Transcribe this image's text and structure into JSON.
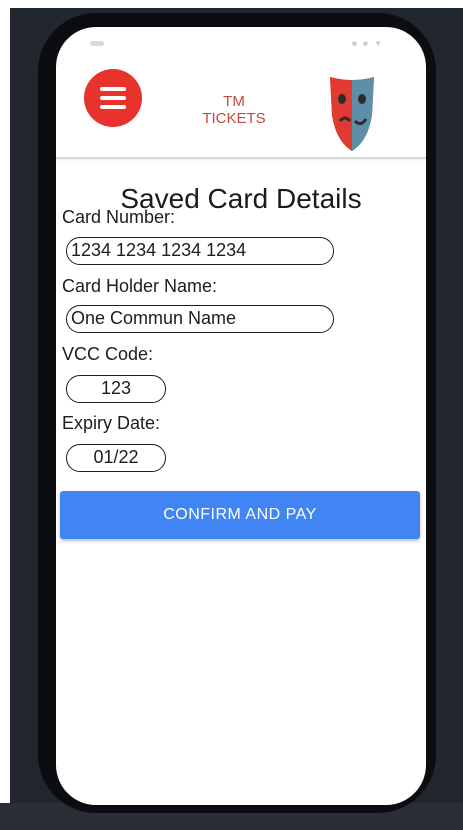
{
  "header": {
    "brand_line1": "TM",
    "brand_line2": "TICKETS"
  },
  "page": {
    "title": "Saved Card Details"
  },
  "form": {
    "card_number_label": "Card Number:",
    "card_number_value": "1234 1234 1234 1234",
    "card_holder_label": "Card Holder Name:",
    "card_holder_value": "One Commun Name",
    "vcc_label": "VCC Code:",
    "vcc_value": "123",
    "expiry_label": "Expiry Date:",
    "expiry_value": "01/22"
  },
  "actions": {
    "confirm_label": "CONFIRM AND PAY"
  },
  "colors": {
    "accent": "#4185f4",
    "brand_red": "#e8322c",
    "background_dark": "#22262e"
  },
  "icons": {
    "menu": "hamburger-menu-icon",
    "logo": "theater-mask-logo"
  }
}
